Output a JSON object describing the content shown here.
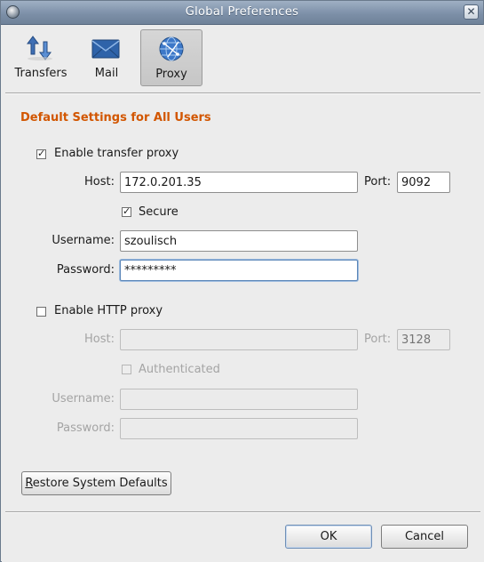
{
  "window": {
    "title": "Global Preferences"
  },
  "tabs": [
    {
      "label": "Transfers",
      "icon": "transfer-arrows-icon",
      "active": false
    },
    {
      "label": "Mail",
      "icon": "mail-envelope-icon",
      "active": false
    },
    {
      "label": "Proxy",
      "icon": "globe-network-icon",
      "active": true
    }
  ],
  "section_title": "Default Settings for All Users",
  "transfer_proxy": {
    "enable_label": "Enable transfer proxy",
    "enabled": true,
    "host_label": "Host:",
    "host_value": "172.0.201.35",
    "port_label": "Port:",
    "port_value": "9092",
    "secure_label": "Secure",
    "secure": true,
    "username_label": "Username:",
    "username_value": "szoulisch",
    "password_label": "Password:",
    "password_value": "*********"
  },
  "http_proxy": {
    "enable_label": "Enable HTTP proxy",
    "enabled": false,
    "host_label": "Host:",
    "host_value": "",
    "port_label": "Port:",
    "port_placeholder": "3128",
    "auth_label": "Authenticated",
    "authenticated": false,
    "username_label": "Username:",
    "username_value": "",
    "password_label": "Password:",
    "password_value": ""
  },
  "buttons": {
    "restore": "Restore System Defaults",
    "ok": "OK",
    "cancel": "Cancel"
  },
  "colors": {
    "section_title": "#d25600",
    "titlebar": "#7d90a8"
  }
}
